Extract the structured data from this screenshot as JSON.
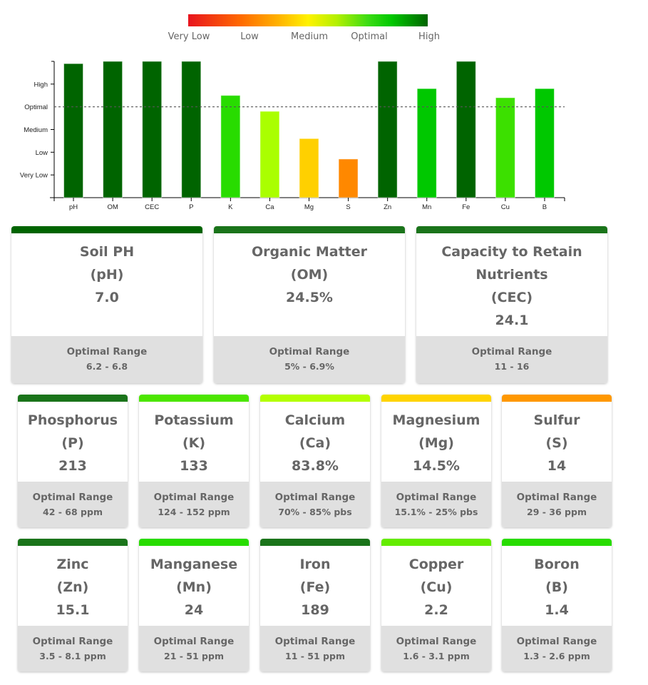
{
  "legend": {
    "labels": [
      "Very Low",
      "Low",
      "Medium",
      "Optimal",
      "High"
    ]
  },
  "chart_data": {
    "type": "bar",
    "title": "",
    "xlabel": "",
    "ylabel": "",
    "categories": [
      "pH",
      "OM",
      "CEC",
      "P",
      "K",
      "Ca",
      "Mg",
      "S",
      "Zn",
      "Mn",
      "Fe",
      "Cu",
      "B"
    ],
    "values": [
      5.9,
      6.0,
      6.0,
      6.0,
      4.5,
      3.8,
      2.6,
      1.7,
      6.0,
      4.8,
      6.0,
      4.4,
      4.8
    ],
    "colors": [
      "#006400",
      "#006400",
      "#006400",
      "#006400",
      "#28dc00",
      "#aaff00",
      "#ffd000",
      "#ff8800",
      "#006400",
      "#00c800",
      "#006400",
      "#3ce000",
      "#00c800"
    ],
    "ylim": [
      0,
      6
    ],
    "yticks": [
      {
        "value": 1,
        "label": "Very Low"
      },
      {
        "value": 2,
        "label": "Low"
      },
      {
        "value": 3,
        "label": "Medium"
      },
      {
        "value": 4,
        "label": "Optimal"
      },
      {
        "value": 5,
        "label": "High"
      }
    ],
    "reference_line": {
      "value": 4,
      "label": "Optimal",
      "style": "dashed"
    },
    "grid": false
  },
  "range_label": "Optimal Range",
  "cards_row1": [
    {
      "name": "Soil PH",
      "name2": "",
      "symbol": "(pH)",
      "value": "7.0",
      "range": "6.2 - 6.8",
      "color": "#006400"
    },
    {
      "name": "Organic Matter",
      "name2": "",
      "symbol": "(OM)",
      "value": "24.5%",
      "range": "5% - 6.9%",
      "color": "#1a741a"
    },
    {
      "name": "Capacity to Retain",
      "name2": "Nutrients",
      "symbol": "(CEC)",
      "value": "24.1",
      "range": "11 - 16",
      "color": "#1a741a"
    }
  ],
  "cards_row2": [
    {
      "name": "Phosphorus",
      "symbol": "(P)",
      "value": "213",
      "range": "42 - 68 ppm",
      "color": "#1a741a"
    },
    {
      "name": "Potassium",
      "symbol": "(K)",
      "value": "133",
      "range": "124 - 152 ppm",
      "color": "#4ce600"
    },
    {
      "name": "Calcium",
      "symbol": "(Ca)",
      "value": "83.8%",
      "range": "70% - 85% pbs",
      "color": "#b4ff00"
    },
    {
      "name": "Magnesium",
      "symbol": "(Mg)",
      "value": "14.5%",
      "range": "15.1% - 25% pbs",
      "color": "#ffd400"
    },
    {
      "name": "Sulfur",
      "symbol": "(S)",
      "value": "14",
      "range": "29 - 36 ppm",
      "color": "#ff9800"
    }
  ],
  "cards_row3": [
    {
      "name": "Zinc",
      "symbol": "(Zn)",
      "value": "15.1",
      "range": "3.5 - 8.1 ppm",
      "color": "#1a741a"
    },
    {
      "name": "Manganese",
      "symbol": "(Mn)",
      "value": "24",
      "range": "21 - 51 ppm",
      "color": "#28dc00"
    },
    {
      "name": "Iron",
      "symbol": "(Fe)",
      "value": "189",
      "range": "11 - 51 ppm",
      "color": "#1a741a"
    },
    {
      "name": "Copper",
      "symbol": "(Cu)",
      "value": "2.2",
      "range": "1.6 - 3.1 ppm",
      "color": "#64ec00"
    },
    {
      "name": "Boron",
      "symbol": "(B)",
      "value": "1.4",
      "range": "1.3 - 2.6 ppm",
      "color": "#28dc00"
    }
  ]
}
